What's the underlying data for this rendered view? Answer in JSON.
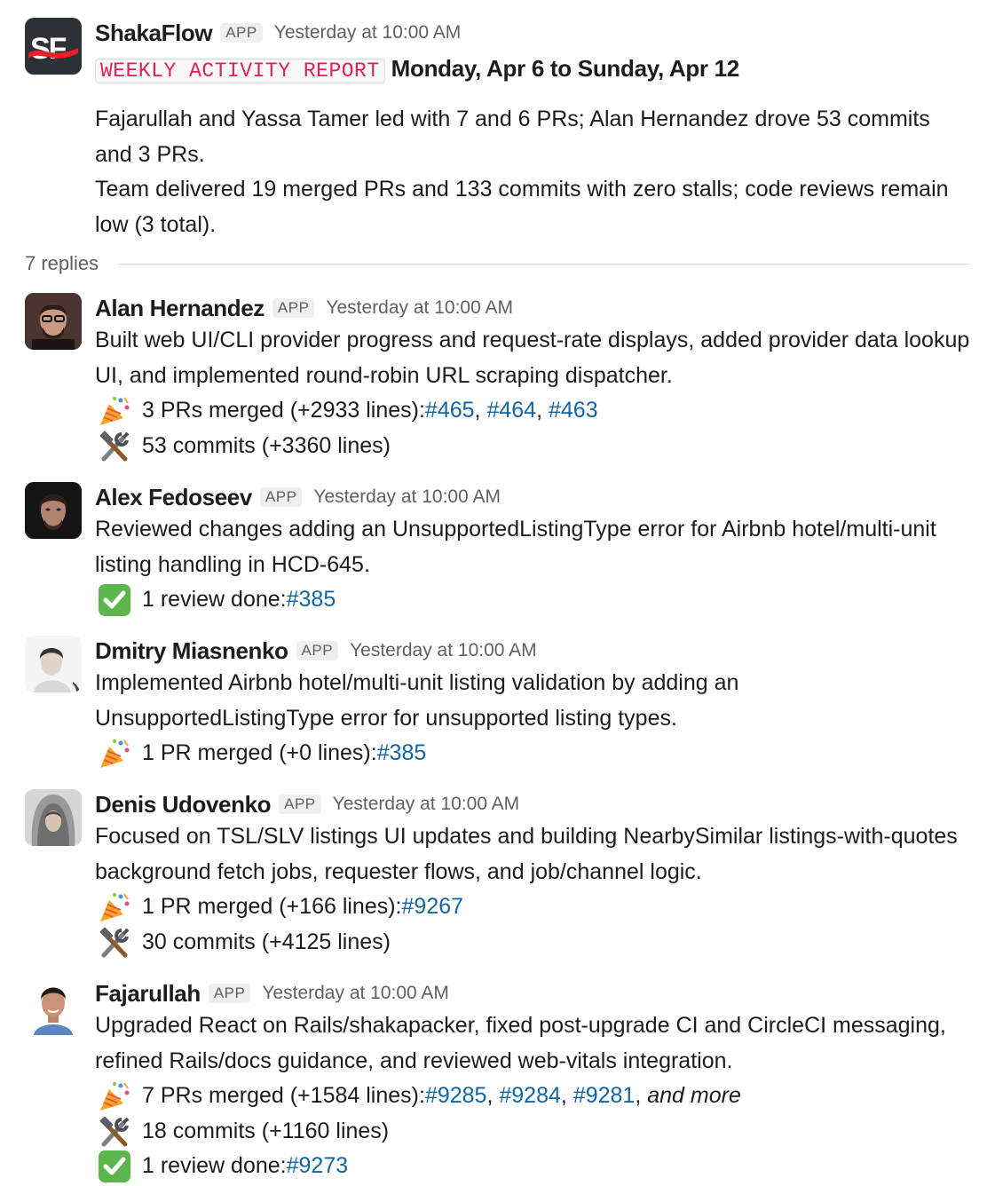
{
  "main": {
    "app_name": "ShakaFlow",
    "app_badge": "APP",
    "time": "Yesterday at 10:00 AM",
    "logo_text": "SF",
    "report_tag": "WEEKLY ACTIVITY REPORT",
    "report_date": "Monday, Apr 6 to Sunday, Apr 12",
    "summary_line1": "Fajarullah and Yassa Tamer led with 7 and 6 PRs; Alan Hernandez drove 53 commits and 3 PRs.",
    "summary_line2": "Team delivered 19 merged PRs and 133 commits with zero stalls; code reviews remain low (3 total)."
  },
  "replies_label": "7 replies",
  "colors": {
    "link": "#1264a3",
    "tag": "#e01e5a",
    "logo_bg": "#2d3136",
    "logo_accent": "#e8202a"
  },
  "replies": [
    {
      "name": "Alan Hernandez",
      "badge": "APP",
      "time": "Yesterday at 10:00 AM",
      "text": "Built web UI/CLI provider progress and request-rate displays, added provider data lookup UI, and implemented round-robin URL scraping dispatcher.",
      "prs": {
        "icon": "party-popper",
        "label": "3 PRs merged (+2933 lines): ",
        "links": [
          "#465",
          "#464",
          "#463"
        ]
      },
      "commits": {
        "icon": "hammer-and-wrench",
        "label": "53 commits (+3360 lines)"
      }
    },
    {
      "name": "Alex Fedoseev",
      "badge": "APP",
      "time": "Yesterday at 10:00 AM",
      "text": "Reviewed changes adding an UnsupportedListingType error for Airbnb hotel/multi-unit listing handling in HCD-645.",
      "reviews": {
        "icon": "check-mark",
        "label": "1 review done: ",
        "links": [
          "#385"
        ]
      }
    },
    {
      "name": "Dmitry Miasnenko",
      "badge": "APP",
      "time": "Yesterday at 10:00 AM",
      "text": "Implemented Airbnb hotel/multi-unit listing validation by adding an UnsupportedListingType error for unsupported listing types.",
      "prs": {
        "icon": "party-popper",
        "label": "1 PR merged (+0 lines): ",
        "links": [
          "#385"
        ]
      }
    },
    {
      "name": "Denis Udovenko",
      "badge": "APP",
      "time": "Yesterday at 10:00 AM",
      "text": "Focused on TSL/SLV listings UI updates and building NearbySimilar listings-with-quotes background fetch jobs, requester flows, and job/channel logic.",
      "prs": {
        "icon": "party-popper",
        "label": "1 PR merged (+166 lines): ",
        "links": [
          "#9267"
        ]
      },
      "commits": {
        "icon": "hammer-and-wrench",
        "label": "30 commits (+4125 lines)"
      }
    },
    {
      "name": "Fajarullah",
      "badge": "APP",
      "time": "Yesterday at 10:00 AM",
      "text": "Upgraded React on Rails/shakapacker, fixed post-upgrade CI and CircleCI messaging, refined Rails/docs guidance, and reviewed web-vitals integration.",
      "prs": {
        "icon": "party-popper",
        "label": "7 PRs merged (+1584 lines): ",
        "links": [
          "#9285",
          "#9284",
          "#9281"
        ],
        "more": "and more"
      },
      "commits": {
        "icon": "hammer-and-wrench",
        "label": "18 commits (+1160 lines)"
      },
      "reviews": {
        "icon": "check-mark",
        "label": "1 review done: ",
        "links": [
          "#9273"
        ]
      }
    }
  ]
}
